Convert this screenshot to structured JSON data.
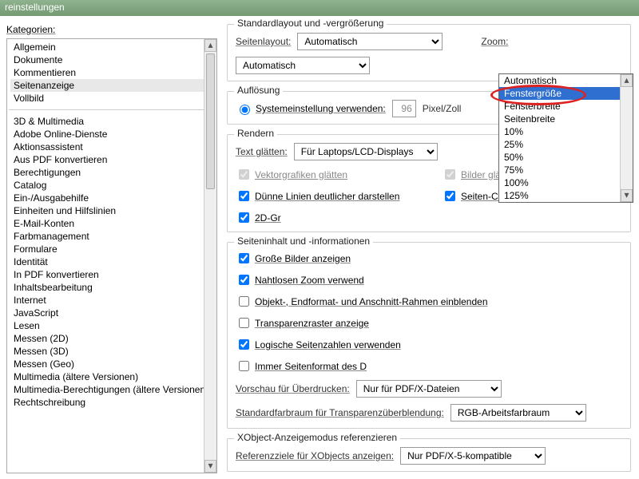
{
  "window": {
    "title": "reinstellungen"
  },
  "sidebar": {
    "label": "Kategorien:",
    "items_top": [
      "Allgemein",
      "Dokumente",
      "Kommentieren",
      "Seitenanzeige",
      "Vollbild"
    ],
    "selected_index": 3,
    "items_bottom": [
      "3D & Multimedia",
      "Adobe Online-Dienste",
      "Aktionsassistent",
      "Aus PDF konvertieren",
      "Berechtigungen",
      "Catalog",
      "Ein-/Ausgabehilfe",
      "Einheiten und Hilfslinien",
      "E-Mail-Konten",
      "Farbmanagement",
      "Formulare",
      "Identität",
      "In PDF konvertieren",
      "Inhaltsbearbeitung",
      "Internet",
      "JavaScript",
      "Lesen",
      "Messen (2D)",
      "Messen (3D)",
      "Messen (Geo)",
      "Multimedia (ältere Versionen)",
      "Multimedia-Berechtigungen (ältere Versionen)",
      "Rechtschreibung"
    ]
  },
  "layout": {
    "legend": "Standardlayout und -vergrößerung",
    "page_layout_label": "Seitenlayout:",
    "page_layout_value": "Automatisch",
    "zoom_label": "Zoom:",
    "zoom_value": "Automatisch",
    "zoom_options": [
      "Automatisch",
      "Fenstergröße",
      "Fensterbreite",
      "Seitenbreite",
      "10%",
      "25%",
      "50%",
      "75%",
      "100%",
      "125%"
    ],
    "zoom_highlight_index": 1
  },
  "resolution": {
    "legend": "Auflösung",
    "use_system": "Systemeinstellung verwenden:",
    "value": "96",
    "unit": "Pixel/Zoll"
  },
  "render": {
    "legend": "Rendern",
    "textsmooth_label": "Text glätten:",
    "textsmooth_value": "Für Laptops/LCD-Displays",
    "vec_smooth": "Vektorgrafiken glätten",
    "img_smooth": "Bilder glätten",
    "thin_lines": "Dünne Linien deutlicher darstellen",
    "page_cache": "Seiten-Cache verwenden",
    "twod": "2D-Gr"
  },
  "pagecontent": {
    "legend": "Seiteninhalt und -informationen",
    "large_images": "Große Bilder anzeigen",
    "smooth_zoom": "Nahtlosen Zoom verwend",
    "obj_frames": "Objekt-, Endformat- und Anschnitt-Rahmen einblenden",
    "trans_grid": "Transparenzraster anzeige",
    "logic_pages": "Logische Seitenzahlen verwenden",
    "always_format": "Immer Seitenformat des D",
    "overprint_label": "Vorschau für Überdrucken:",
    "overprint_value": "Nur für PDF/X-Dateien",
    "colorspace_label": "Standardfarbraum für Transparenzüberblendung:",
    "colorspace_value": "RGB-Arbeitsfarbraum"
  },
  "xobject": {
    "legend": "XObject-Anzeigemodus referenzieren",
    "ref_targets_label": "Referenzziele für XObjects anzeigen:",
    "ref_targets_value": "Nur PDF/X-5-kompatible"
  }
}
